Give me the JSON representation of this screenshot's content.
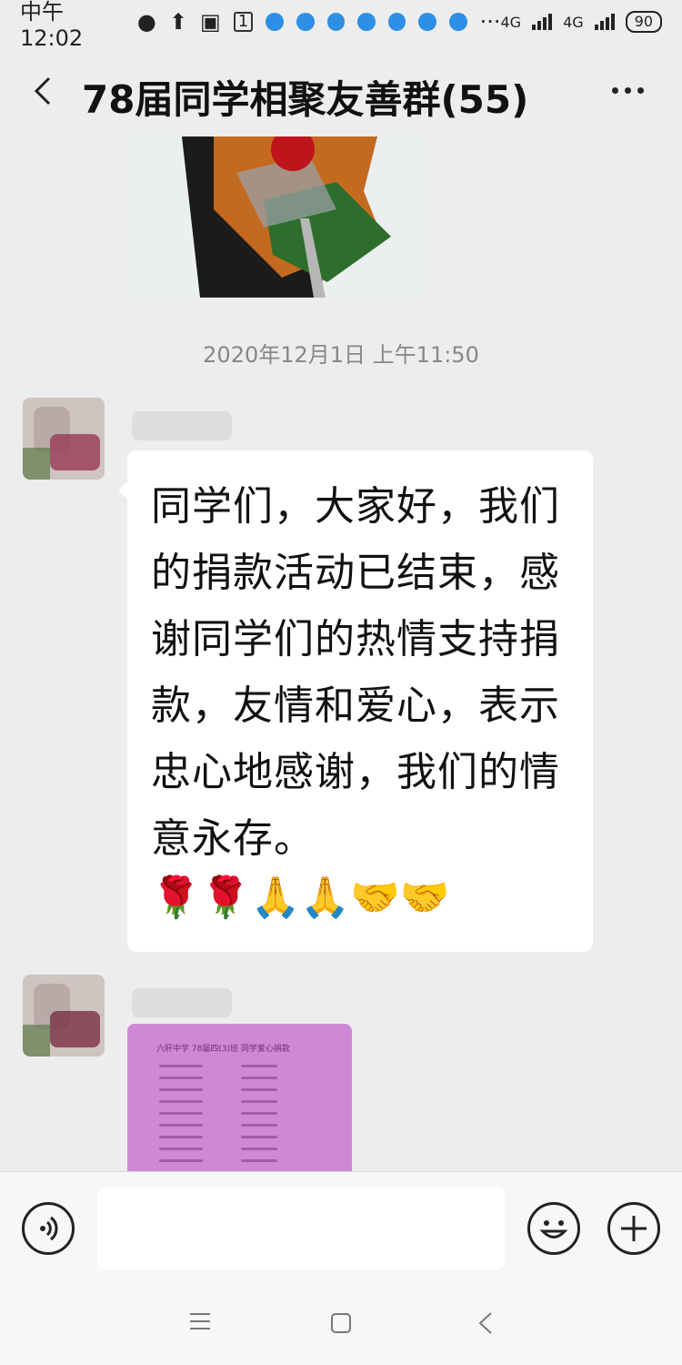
{
  "status_bar": {
    "time": "中午12:02",
    "ellipsis": "···",
    "network_1": "4G",
    "network_2": "4G",
    "battery": "90",
    "sim_box": "1"
  },
  "header": {
    "title": "78届同学相聚友善群(55)"
  },
  "chat": {
    "timestamp": "2020年12月1日 上午11:50",
    "message_text": "同学们，大家好，我们的捐款活动已结束，感谢同学们的热情支持捐款，友情和爱心，表示忠心地感谢，我们的情意永存。",
    "message_emojis": "🌹🌹🙏🙏🤝🤝",
    "document_photo_title": "六肝中学 78届四(3)班 同学爱心捐款"
  },
  "icons": {
    "back": "chevron-left-icon",
    "more": "more-dots-icon",
    "voice": "voice-icon",
    "emoji": "emoji-icon",
    "plus": "plus-icon",
    "nav_menu": "menu-icon",
    "nav_home": "home-square-icon",
    "nav_back": "triangle-back-icon"
  },
  "colors": {
    "background": "#ededed",
    "bubble": "#ffffff",
    "document_photo": "#cf88d6"
  }
}
